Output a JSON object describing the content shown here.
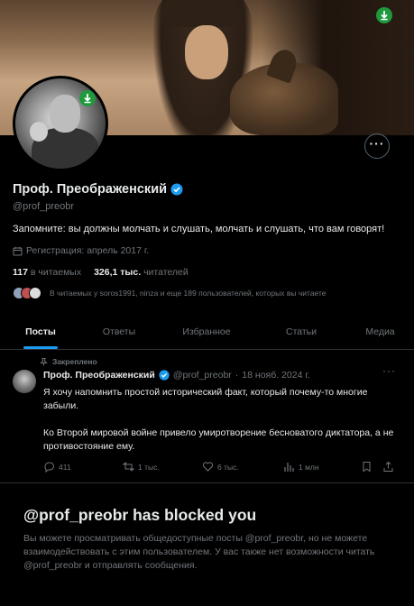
{
  "profile": {
    "name": "Проф. Преображенский",
    "handle": "@prof_preobr",
    "bio": "Запомните: вы должны молчать и слушать, молчать и слушать, что вам говорят!",
    "joined": "Регистрация: апрель 2017 г.",
    "following_count": "117",
    "following_label": "в читаемых",
    "followers_count": "326,1 тыс.",
    "followers_label": "читателей",
    "followed_by": "В читаемых у soros1991, ninza и еще 189 пользователей, которых вы читаете"
  },
  "tabs": [
    {
      "label": "Посты",
      "active": true
    },
    {
      "label": "Ответы"
    },
    {
      "label": "Избранное"
    },
    {
      "label": "Статьи"
    },
    {
      "label": "Медиа"
    }
  ],
  "post": {
    "pinned_label": "Закреплено",
    "author": "Проф. Преображенский",
    "handle": "@prof_preobr",
    "separator": "·",
    "date": "18 нояб. 2024 г.",
    "text_1": "Я хочу напомнить простой исторический факт, который почему-то многие забыли.",
    "text_2": "Ко Второй мировой войне привело умиротворение бесноватого диктатора, а не противостояние ему.",
    "replies": "411",
    "reposts": "1 тыс.",
    "likes": "6 тыс.",
    "views": "1 млн"
  },
  "blocked": {
    "title": "@prof_preobr has blocked you",
    "description": "Вы можете просматривать общедоступные посты @prof_preobr, но не можете взаимодействовать с этим пользователем. У вас также нет возможности читать @prof_preobr и отправлять сообщения."
  },
  "colors": {
    "accent": "#1d9bf0",
    "download_badge": "#1e9a3c",
    "muted": "#71767b",
    "border": "#2f3336"
  }
}
